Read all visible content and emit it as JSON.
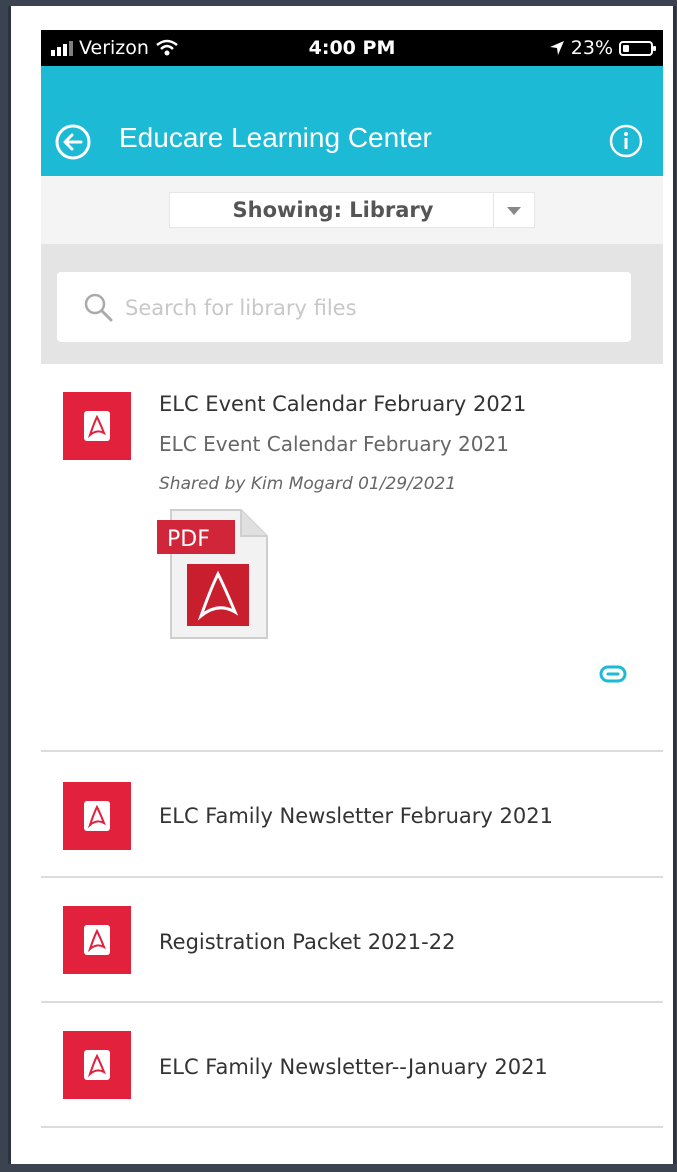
{
  "status_bar": {
    "carrier": "Verizon",
    "time": "4:00 PM",
    "battery": "23%"
  },
  "header": {
    "title": "Educare Learning Center"
  },
  "filter": {
    "label": "Showing: Library"
  },
  "search": {
    "placeholder": "Search for library files",
    "value": ""
  },
  "files": [
    {
      "title": "ELC Event Calendar February 2021",
      "subtitle": "ELC Event Calendar February 2021",
      "shared_by": "Shared by Kim Mogard 01/29/2021",
      "thumb_label": "PDF"
    },
    {
      "title": "ELC Family Newsletter February 2021"
    },
    {
      "title": "Registration Packet 2021-22"
    },
    {
      "title": "ELC Family Newsletter--January 2021"
    }
  ],
  "colors": {
    "header": "#1dbad6",
    "file_icon": "#e2213d",
    "link": "#1dbad6"
  },
  "icons": {
    "back": "back-arrow-circle-icon",
    "info": "info-circle-icon",
    "search": "search-icon",
    "file": "pdf-file-icon",
    "link": "link-icon"
  }
}
